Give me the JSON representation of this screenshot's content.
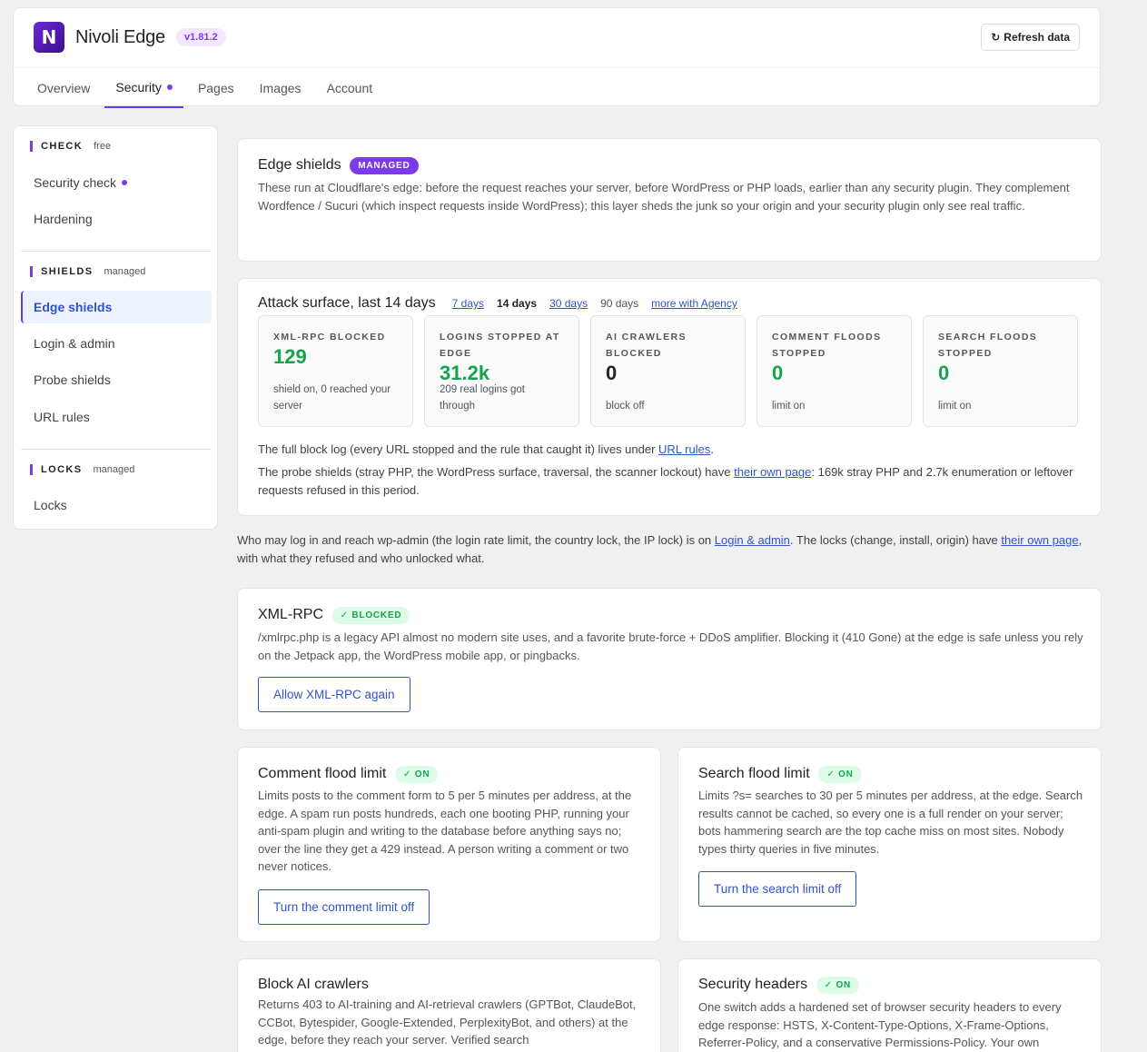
{
  "app": {
    "logo_letter": "N",
    "name": "Nivoli Edge",
    "version": "v1.81.2",
    "refresh_label": "Refresh data"
  },
  "nav": {
    "tabs": [
      {
        "label": "Overview"
      },
      {
        "label": "Security"
      },
      {
        "label": "Pages"
      },
      {
        "label": "Images"
      },
      {
        "label": "Account"
      }
    ]
  },
  "sidebar": {
    "check": {
      "label": "CHECK",
      "tag": "free",
      "items": [
        "Security check",
        "Hardening"
      ]
    },
    "shields": {
      "label": "SHIELDS",
      "tag": "managed",
      "items": [
        "Edge shields",
        "Login & admin",
        "Probe shields",
        "URL rules"
      ]
    },
    "locks": {
      "label": "LOCKS",
      "tag": "managed",
      "items": [
        "Locks"
      ]
    }
  },
  "edge_shields": {
    "title": "Edge shields",
    "badge": "MANAGED",
    "description": "These run at Cloudflare's edge: before the request reaches your server, before WordPress or PHP loads, earlier than any security plugin. They complement Wordfence / Sucuri (which inspect requests inside WordPress); this layer sheds the junk so your origin and your security plugin only see real traffic."
  },
  "attack": {
    "title": "Attack surface, last 14 days",
    "ranges": [
      "7 days",
      "14 days",
      "30 days",
      "90 days",
      "more with Agency"
    ],
    "stats": [
      {
        "label": "XML-RPC BLOCKED",
        "value": "129",
        "sub": "shield on, 0 reached your server"
      },
      {
        "label": "LOGINS STOPPED AT EDGE",
        "value": "31.2k",
        "sub": "209 real logins got through"
      },
      {
        "label": "AI CRAWLERS BLOCKED",
        "value": "0",
        "sub": "block off"
      },
      {
        "label": "COMMENT FLOODS STOPPED",
        "value": "0",
        "sub": "limit on"
      },
      {
        "label": "SEARCH FLOODS STOPPED",
        "value": "0",
        "sub": "limit on"
      }
    ],
    "note1_pre": "The full block log (every URL stopped and the rule that caught it) lives under ",
    "note1_link": "URL rules",
    "note1_post": ".",
    "note2_pre": "The probe shields (stray PHP, the WordPress surface, traversal, the scanner lockout) have ",
    "note2_link": "their own page",
    "note2_post": ": 169k stray PHP and 2.7k enumeration or leftover requests refused in this period."
  },
  "login_note": {
    "pre": "Who may log in and reach wp-admin (the login rate limit, the country lock, the IP lock) is on ",
    "link1": "Login & admin",
    "mid": ". The locks (change, install, origin) have ",
    "link2": "their own page",
    "post": ", with what they refused and who unlocked what."
  },
  "xmlrpc": {
    "title": "XML-RPC",
    "badge": "✓ BLOCKED",
    "description": "/xmlrpc.php is a legacy API almost no modern site uses, and a favorite brute-force + DDoS amplifier. Blocking it (410 Gone) at the edge is safe unless you rely on the Jetpack app, the WordPress mobile app, or pingbacks.",
    "button": "Allow XML-RPC again"
  },
  "comment_flood": {
    "title": "Comment flood limit",
    "badge": "✓ ON",
    "description": "Limits posts to the comment form to 5 per 5 minutes per address, at the edge. A spam run posts hundreds, each one booting PHP, running your anti-spam plugin and writing to the database before anything says no; over the line they get a 429 instead. A person writing a comment or two never notices.",
    "button": "Turn the comment limit off"
  },
  "search_flood": {
    "title": "Search flood limit",
    "badge": "✓ ON",
    "description": "Limits ?s= searches to 30 per 5 minutes per address, at the edge. Search results cannot be cached, so every one is a full render on your server; bots hammering search are the top cache miss on most sites. Nobody types thirty queries in five minutes.",
    "button": "Turn the search limit off"
  },
  "ai_crawlers": {
    "title": "Block AI crawlers",
    "description": "Returns 403 to AI-training and AI-retrieval crawlers (GPTBot, ClaudeBot, CCBot, Bytespider, Google-Extended, PerplexityBot, and others) at the edge, before they reach your server. Verified search"
  },
  "security_headers": {
    "title": "Security headers",
    "badge": "✓ ON",
    "description": "One switch adds a hardened set of browser security headers to every edge response: HSTS, X-Content-Type-Options, X-Frame-Options, Referrer-Policy, and a conservative Permissions-Policy. Your own"
  },
  "colors": {
    "accent": "#7c3aed",
    "link": "#2f54c8",
    "success": "#16a34a",
    "background": "#f0f0f1"
  }
}
